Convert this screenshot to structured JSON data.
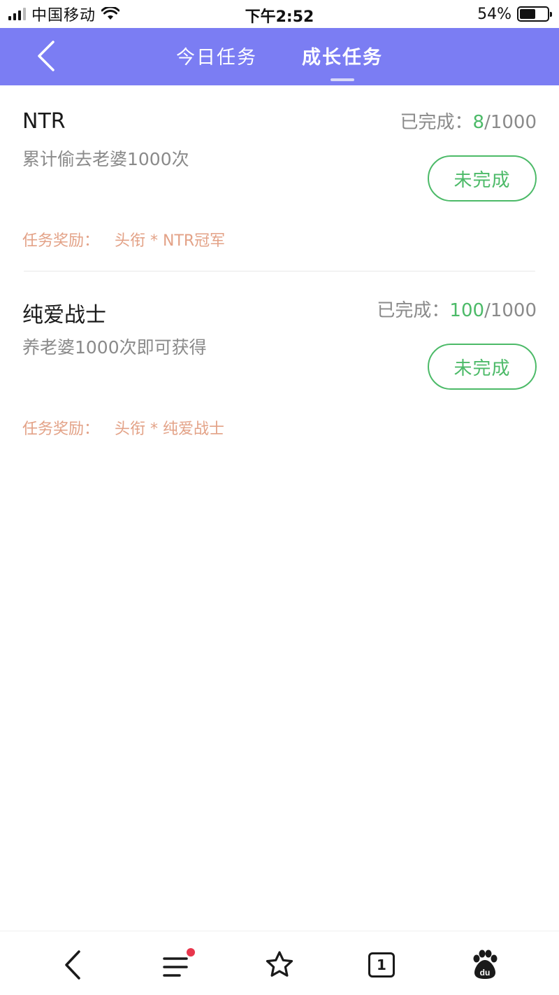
{
  "status_bar": {
    "carrier": "中国移动",
    "time": "下午2:52",
    "battery": "54%"
  },
  "nav": {
    "tabs": [
      {
        "label": "今日任务",
        "active": false
      },
      {
        "label": "成长任务",
        "active": true
      }
    ],
    "header_color": "#7b7df3"
  },
  "tasks": [
    {
      "title": "NTR",
      "description": "累计偷去老婆1000次",
      "progress_label": "已完成：",
      "progress_done": "8",
      "progress_total": "/1000",
      "status": "未完成",
      "reward_label": "任务奖励：",
      "reward_value": "头衔 * NTR冠军"
    },
    {
      "title": "纯爱战士",
      "description": "养老婆1000次即可获得",
      "progress_label": "已完成：",
      "progress_done": "100",
      "progress_total": "/1000",
      "status": "未完成",
      "reward_label": "任务奖励：",
      "reward_value": "头衔 * 纯爱战士"
    }
  ],
  "toolbar": {
    "tab_count": "1",
    "icons": [
      "back-arrow-icon",
      "menu-icon",
      "star-icon",
      "tabs-icon",
      "baidu-paw-icon"
    ]
  },
  "colors": {
    "accent_green": "#4cba68",
    "reward_orange": "#e3a287",
    "notification_red": "#e8364c"
  }
}
